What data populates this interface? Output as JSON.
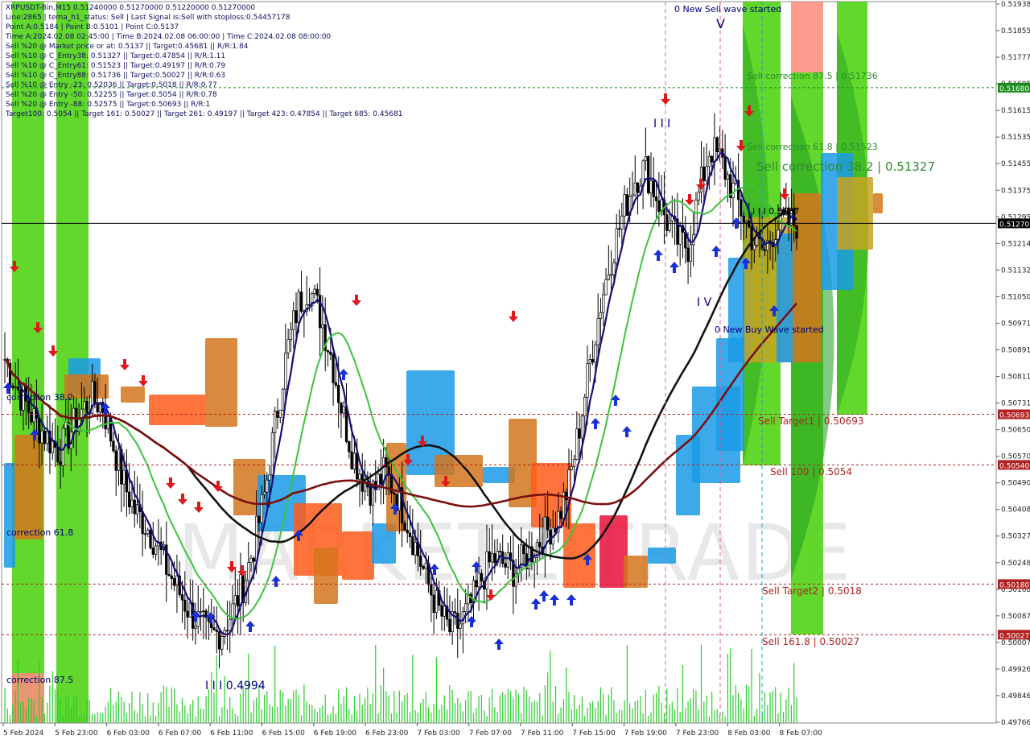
{
  "header_lines": [
    "XRPUSDT-Bin,M15  0.51240000 0.51270000 0.51220000 0.51270000",
    "Line:2865  | tema_h1_status: Sell  | Last Signal is:Sell with stoploss:0.54457178",
    "Point A:0.5184  | Point B:0.5101  | Point C:0.5137",
    "Time A:2024.02.08 02:45:00  | Time B:2024.02.08 06:00:00  | Time C:2024.02.08 08:00:00",
    "Sell %20 @ Market price or at: 0.5137  || Target:0.45681  || R/R:1.84",
    "Sell %10 @ C_Entry38: 0.51327  || Target:0.47854  || R/R:1.11",
    "Sell %10 @ C_Entry61: 0.51523  || Target:0.49197  || R/R:0.79",
    "Sell %10 @ C_Entry88: 0.51736  || Target:0.50027  || R/R:0.63",
    "Sell %10 @ Entry -23: 0.52036  || Target:0.5018  || R/R:0.77",
    "Sell %20 @ Entry -50: 0.52255  || Target:0.5054  || R/R:0.78",
    "Sell %20 @ Entry -88: 0.52575  || Target:0.50693  || R/R:1",
    "Target100: 0.5054  || Target 161: 0.50027  || Target 261: 0.49197  || Target 423: 0.47854  || Target 685: 0.45681"
  ],
  "watermark": "MARKETZITRADE",
  "current_price": "0.51270",
  "chart_data": {
    "type": "candlestick",
    "symbol": "XRPUSDT-Bin",
    "timeframe": "M15",
    "y_range": [
      0.4976,
      0.5194
    ],
    "y_ticks": [
      "0.51938",
      "0.51855",
      "0.51777",
      "0.51695",
      "0.51615",
      "0.51535",
      "0.51455",
      "0.51375",
      "0.51295",
      "0.51214",
      "0.51132",
      "0.51050",
      "0.50971",
      "0.50891",
      "0.50811",
      "0.50731",
      "0.50650",
      "0.50570",
      "0.50490",
      "0.50408",
      "0.50327",
      "0.50248",
      "0.50168",
      "0.50087",
      "0.50007",
      "0.49926",
      "0.49846",
      "0.49766"
    ],
    "x_labels": [
      "5 Feb 2024",
      "5 Feb 23:00",
      "6 Feb 03:00",
      "6 Feb 07:00",
      "6 Feb 11:00",
      "6 Feb 15:00",
      "6 Feb 19:00",
      "6 Feb 23:00",
      "7 Feb 03:00",
      "7 Feb 07:00",
      "7 Feb 11:00",
      "7 Feb 15:00",
      "7 Feb 19:00",
      "7 Feb 23:00",
      "8 Feb 03:00",
      "8 Feb 07:00"
    ],
    "price_close_path": [
      0.5086,
      0.5078,
      0.5072,
      0.5066,
      0.5062,
      0.5058,
      0.5064,
      0.507,
      0.5074,
      0.5072,
      0.506,
      0.5048,
      0.504,
      0.5036,
      0.503,
      0.5022,
      0.5016,
      0.501,
      0.5006,
      0.5002,
      0.5004,
      0.501,
      0.5018,
      0.503,
      0.5046,
      0.5068,
      0.5088,
      0.5102,
      0.5108,
      0.51,
      0.5088,
      0.5072,
      0.5058,
      0.505,
      0.5046,
      0.5052,
      0.5046,
      0.5038,
      0.5028,
      0.5018,
      0.501,
      0.5004,
      0.5006,
      0.5012,
      0.502,
      0.5026,
      0.5024,
      0.5022,
      0.5026,
      0.503,
      0.5034,
      0.5038,
      0.5048,
      0.5066,
      0.5086,
      0.5104,
      0.5118,
      0.513,
      0.514,
      0.5144,
      0.5136,
      0.5128,
      0.5122,
      0.512,
      0.5136,
      0.515,
      0.5146,
      0.5138,
      0.513,
      0.5122,
      0.5118,
      0.5126,
      0.5127,
      0.5127
    ],
    "levels": [
      {
        "label": "0.51680",
        "value": 0.5168,
        "color": "#1a8c1a"
      },
      {
        "label": "0.51270",
        "value": 0.5127,
        "color": "#000000"
      },
      {
        "label": "0.50693",
        "value": 0.50693,
        "color": "#b22222"
      },
      {
        "label": "0.50540",
        "value": 0.5054,
        "color": "#b22222"
      },
      {
        "label": "0.50180",
        "value": 0.5018,
        "color": "#b22222"
      },
      {
        "label": "0.50027",
        "value": 0.50027,
        "color": "#b22222"
      }
    ],
    "annotations": [
      {
        "text": "0 New Sell wave started",
        "x_frac": 0.0,
        "price": 0.5192,
        "color": "#000080"
      },
      {
        "text": "Sell correction 87.5 | 0.51736",
        "price": 0.51736,
        "color": "#2e8b2e"
      },
      {
        "text": "Sell correction 61.8 | 0.51523",
        "price": 0.51523,
        "color": "#2e8b2e"
      },
      {
        "text": "Sell correction 38.2 | 0.51327",
        "price": 0.51327,
        "color": "#2e8b2e"
      },
      {
        "text": "I I I 0.5137",
        "price": 0.5146,
        "color": "#000000"
      },
      {
        "text": "0 New Buy Wave started",
        "price": 0.5097,
        "color": "#000080"
      },
      {
        "text": "Sell Target1 | 0.50693",
        "price": 0.50693,
        "color": "#b22222"
      },
      {
        "text": "Sell 100 | 0.5054",
        "price": 0.5054,
        "color": "#b22222"
      },
      {
        "text": "Sell Target2 | 0.5018",
        "price": 0.5018,
        "color": "#b22222"
      },
      {
        "text": "Sell 161.8 | 0.50027",
        "price": 0.50027,
        "color": "#b22222"
      },
      {
        "text": "correction 38.2",
        "price": 0.5074,
        "color": "#000080"
      },
      {
        "text": "correction 61.8",
        "price": 0.5033,
        "color": "#000080"
      },
      {
        "text": "correction 87.5",
        "price": 0.499,
        "color": "#000080"
      },
      {
        "text": "I I I 0.4994",
        "price": 0.4986,
        "color": "#000080"
      },
      {
        "text": "V",
        "price": 0.5188,
        "color": "#000080"
      },
      {
        "text": "I I I",
        "price": 0.5154,
        "color": "#000080"
      },
      {
        "text": "I V",
        "price": 0.5103,
        "color": "#000080"
      }
    ]
  }
}
